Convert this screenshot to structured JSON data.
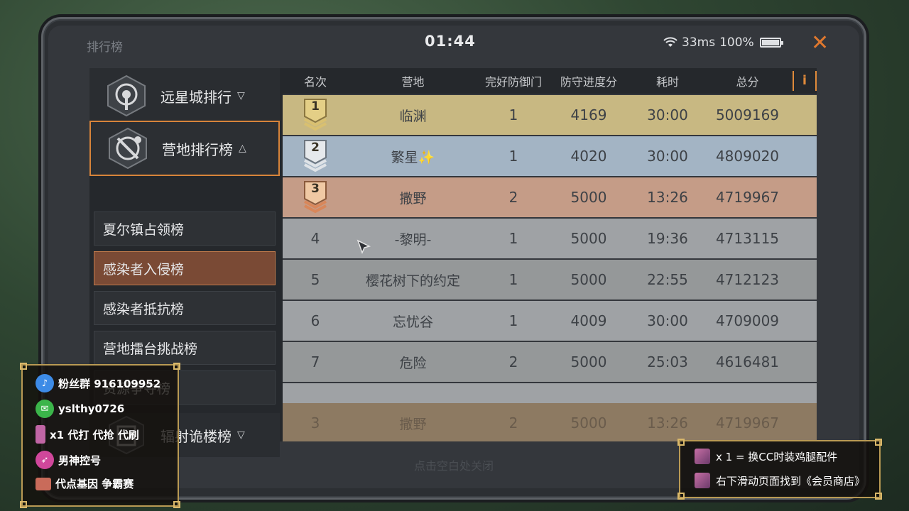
{
  "header": {
    "screen_title": "排行榜",
    "clock": "01:44",
    "latency": "33ms",
    "battery": "100%",
    "battery_level": 1.0,
    "close_symbol": "✕"
  },
  "sidebar": {
    "categories": [
      {
        "label": "远星城排行",
        "arrow": "▽",
        "icon": "target-emblem-icon"
      },
      {
        "label": "营地排行榜",
        "arrow": "△",
        "icon": "crossed-swords-emblem-icon"
      },
      {
        "label": "辐射诡楼榜",
        "arrow": "▽",
        "icon": "building-emblem-icon"
      }
    ],
    "sub_items": [
      {
        "label": "夏尔镇占领榜"
      },
      {
        "label": "感染者入侵榜"
      },
      {
        "label": "感染者抵抗榜"
      },
      {
        "label": "营地擂台挑战榜"
      },
      {
        "label": "资源争夺榜"
      }
    ]
  },
  "table": {
    "columns": [
      "名次",
      "营地",
      "完好防御门",
      "防守进度分",
      "耗时",
      "总分"
    ],
    "info_symbol": "i",
    "rows": [
      {
        "rank": "1",
        "camp": "临渊",
        "doors": "1",
        "progress": "4169",
        "time": "30:00",
        "total": "5009169"
      },
      {
        "rank": "2",
        "camp": "繁星✨",
        "doors": "1",
        "progress": "4020",
        "time": "30:00",
        "total": "4809020"
      },
      {
        "rank": "3",
        "camp": "撒野",
        "doors": "2",
        "progress": "5000",
        "time": "13:26",
        "total": "4719967"
      },
      {
        "rank": "4",
        "camp": "-黎明-",
        "doors": "1",
        "progress": "5000",
        "time": "19:36",
        "total": "4713115"
      },
      {
        "rank": "5",
        "camp": "樱花树下的约定",
        "doors": "1",
        "progress": "5000",
        "time": "22:55",
        "total": "4712123"
      },
      {
        "rank": "6",
        "camp": "忘忧谷",
        "doors": "1",
        "progress": "4009",
        "time": "30:00",
        "total": "4709009"
      },
      {
        "rank": "7",
        "camp": "危险",
        "doors": "2",
        "progress": "5000",
        "time": "25:03",
        "total": "4616481"
      }
    ],
    "my_row": {
      "rank": "3",
      "camp": "撒野",
      "doors": "2",
      "progress": "5000",
      "time": "13:26",
      "total": "4719967"
    }
  },
  "hint": "点击空白处关闭",
  "overlay_left": {
    "fan_group": "粉丝群 916109952",
    "wechat": "yslthy0726",
    "service": "x1 代打 代抢 代刷",
    "account": "男神控号",
    "event": "代点基因 争霸赛"
  },
  "overlay_right": {
    "line1": "x 1 = 换CC时装鸡腿配件",
    "line2": "右下滑动页面找到《会员商店》"
  },
  "colors": {
    "accent": "#e0782e",
    "gold_row": "#c8b882",
    "silver_row": "#a3b4c4",
    "bronze_row": "#c59c87"
  }
}
